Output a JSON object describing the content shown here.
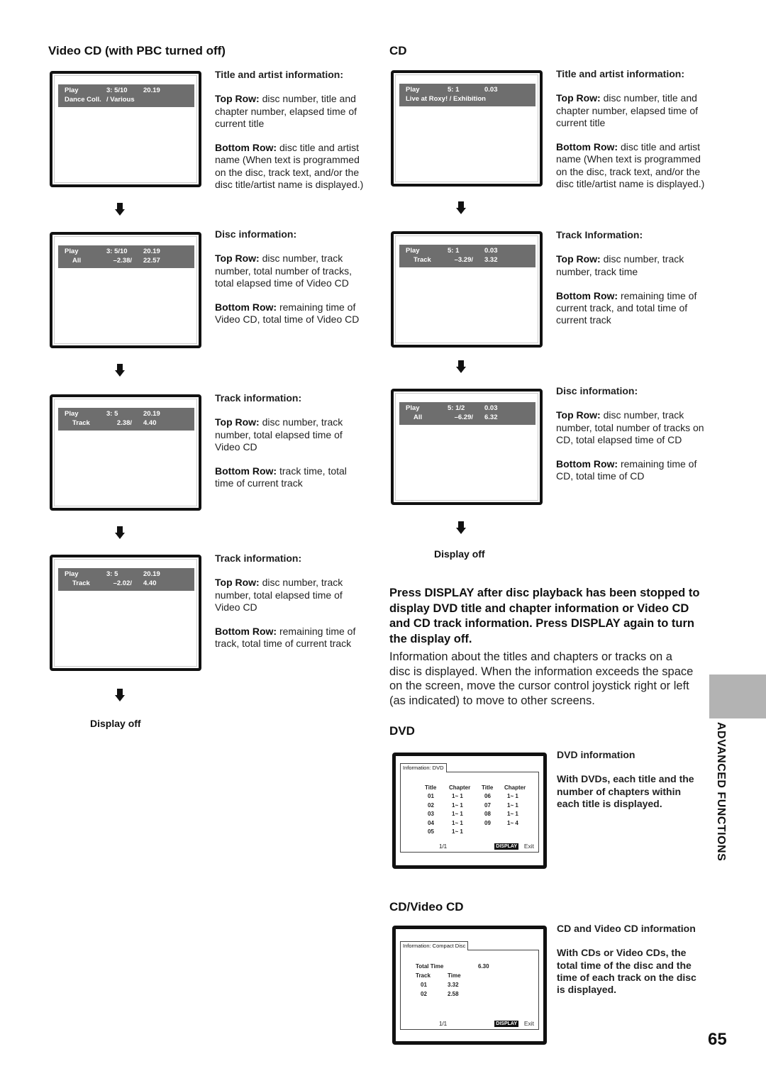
{
  "page_number": "65",
  "side_tab": {
    "label": "ADVANCED FUNCTIONS",
    "color": "#b3b3b3"
  },
  "sections": {
    "vcd_title": "Video CD (with PBC turned off)",
    "cd_title": "CD",
    "dvd_title": "DVD",
    "cdvcd_title": "CD/Video CD"
  },
  "vcd_screens": [
    {
      "r1": {
        "a": "Play",
        "b": "3: 5/10",
        "c": "20.19"
      },
      "r2": {
        "a": "Dance Coll.",
        "b": "/ Various",
        "c": ""
      },
      "desc": {
        "head": "Title and artist information:",
        "top_label": "Top Row:",
        "top": " disc number, title and chapter number, elapsed time of current title",
        "bottom_label": "Bottom Row:",
        "bottom": " disc title and artist name (When text is programmed on the disc, track text, and/or the disc title/artist name is displayed.)"
      }
    },
    {
      "r1": {
        "a": "Play",
        "b": "3: 5/10",
        "c": "20.19"
      },
      "r2": {
        "a": "All",
        "b": "–2.38/",
        "c": "22.57"
      },
      "desc": {
        "head": "Disc information:",
        "top_label": "Top Row:",
        "top": " disc number, track number, total number of tracks, total elapsed time of Video CD",
        "bottom_label": "Bottom Row:",
        "bottom": " remaining time of Video CD, total time of Video CD"
      }
    },
    {
      "r1": {
        "a": "Play",
        "b": "3: 5",
        "c": "20.19"
      },
      "r2": {
        "a": "Track",
        "b": "2.38/",
        "c": "4.40"
      },
      "desc": {
        "head": "Track information:",
        "top_label": "Top Row:",
        "top": " disc number, track number, total elapsed time of Video CD",
        "bottom_label": "Bottom Row:",
        "bottom": " track time, total time of current track"
      }
    },
    {
      "r1": {
        "a": "Play",
        "b": "3: 5",
        "c": "20.19"
      },
      "r2": {
        "a": "Track",
        "b": "–2.02/",
        "c": "4.40"
      },
      "desc": {
        "head": "Track information:",
        "top_label": "Top Row:",
        "top": " disc number, track number, total elapsed time of Video CD",
        "bottom_label": "Bottom Row:",
        "bottom": " remaining time of track, total time of current track"
      }
    }
  ],
  "vcd_display_off": "Display off",
  "cd_screens": [
    {
      "r1": {
        "a": "Play",
        "b": "5: 1",
        "c": "0.03"
      },
      "r2": {
        "a": "Live at Roxy!  /  Exhibition",
        "b": "",
        "c": ""
      },
      "desc": {
        "head": "Title and artist information:",
        "top_label": "Top Row:",
        "top": " disc number, title and chapter number, elapsed time of current title",
        "bottom_label": "Bottom Row:",
        "bottom": " disc title and artist name (When text is programmed on the disc, track text, and/or the disc title/artist name is displayed.)"
      }
    },
    {
      "r1": {
        "a": "Play",
        "b": "5: 1",
        "c": "0.03"
      },
      "r2": {
        "a": "Track",
        "b": "–3.29/",
        "c": "3.32"
      },
      "desc": {
        "head": "Track Information:",
        "top_label": "Top Row:",
        "top": " disc number, track number, track time",
        "bottom_label": "Bottom Row:",
        "bottom": " remaining time of current track, and total time of current track"
      }
    },
    {
      "r1": {
        "a": "Play",
        "b": "5: 1/2",
        "c": "0.03"
      },
      "r2": {
        "a": "All",
        "b": "–6.29/",
        "c": "6.32"
      },
      "desc": {
        "head": "Disc information:",
        "top_label": "Top Row:",
        "top": " disc number, track number, total number of tracks on CD, total elapsed time of CD",
        "bottom_label": "Bottom Row:",
        "bottom": " remaining time of CD, total time of CD"
      }
    }
  ],
  "cd_display_off": "Display off",
  "instructions": {
    "bold": "Press DISPLAY after disc playback has been stopped to display DVD title and chapter information or Video CD and CD track information. Press DISPLAY again to turn the display off.",
    "body": "Information about the titles and chapters or tracks on a disc is displayed. When the information exceeds the space on the screen, move the cursor control joystick right or left (as indicated) to move to other screens."
  },
  "dvd_info": {
    "tab": "Information: DVD",
    "headers": [
      "Title",
      "Chapter",
      "Title",
      "Chapter"
    ],
    "left": [
      [
        "01",
        "1~ 1"
      ],
      [
        "02",
        "1~ 1"
      ],
      [
        "03",
        "1~ 1"
      ],
      [
        "04",
        "1~ 1"
      ],
      [
        "05",
        "1~ 1"
      ]
    ],
    "right": [
      [
        "06",
        "1~ 1"
      ],
      [
        "07",
        "1~ 1"
      ],
      [
        "08",
        "1~ 1"
      ],
      [
        "09",
        "1~ 4"
      ]
    ],
    "page": "1/1",
    "display_btn": "DISPLAY",
    "exit": "Exit",
    "desc_head": "DVD information",
    "desc_body": "With DVDs, each title and the number of chapters within each title is displayed."
  },
  "cd_info": {
    "tab": "Information: Compact Disc",
    "total_label": "Total Time",
    "total_value": "6.30",
    "headers": [
      "Track",
      "Time"
    ],
    "rows": [
      [
        "01",
        "3.32"
      ],
      [
        "02",
        "2.58"
      ]
    ],
    "page": "1/1",
    "display_btn": "DISPLAY",
    "exit": "Exit",
    "desc_head": "CD and Video CD information",
    "desc_body": "With CDs or Video CDs, the total time of the disc and the time of each track on the disc is displayed."
  }
}
